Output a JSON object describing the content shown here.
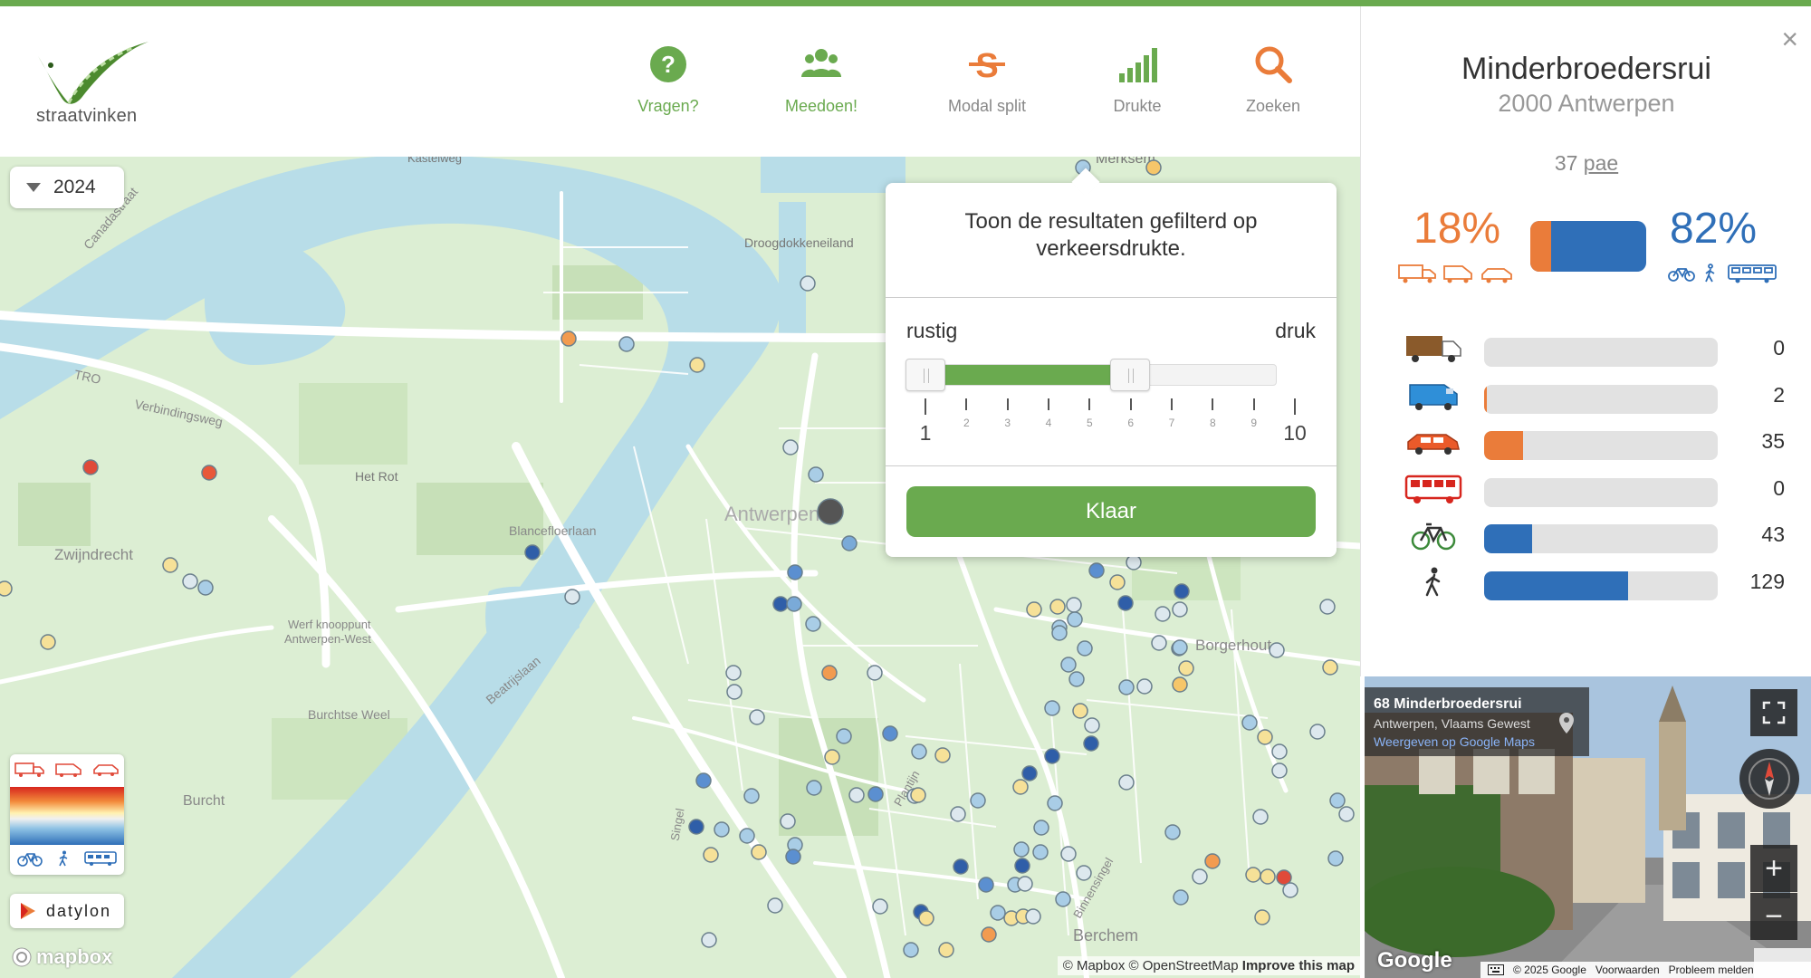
{
  "brand": {
    "name": "straatvinken"
  },
  "nav": [
    {
      "label": "Vragen?",
      "icon": "question-icon",
      "color": "#6aaa4f"
    },
    {
      "label": "Meedoen!",
      "icon": "people-icon",
      "color": "#6aaa4f"
    },
    {
      "label": "Modal split",
      "icon": "modal-split-icon",
      "color": "#888888"
    },
    {
      "label": "Drukte",
      "icon": "signal-bars-icon",
      "color": "#888888"
    },
    {
      "label": "Zoeken",
      "icon": "search-icon",
      "color": "#888888"
    }
  ],
  "map": {
    "year": "2024",
    "labels": {
      "kastelweg": "Kastelweg",
      "merksem": "Merksem",
      "canadastraat": "Canadastraat",
      "droogdokken": "Droogdokkeneiland",
      "tro": "TRO",
      "verbindingsweg": "Verbindingsweg",
      "hetrot": "Het Rot",
      "antwerpen": "Antwerpen",
      "blancefloer": "Blancefloerlaan",
      "zwijndrecht": "Zwijndrecht",
      "werf1": "Werf knooppunt",
      "werf2": "Antwerpen-West",
      "burchtseweel": "Burchtse Weel",
      "beatrijslaan": "Beatrijslaan",
      "burcht": "Burcht",
      "borgerhout": "Borgerhout",
      "berchem": "Berchem",
      "singel": "Singel",
      "binnensingel": "Binnensingel",
      "plantijn": "Plantijn"
    },
    "legend_icons_top": [
      "truck-icon",
      "van-icon",
      "car-icon"
    ],
    "legend_icons_bottom": [
      "bike-icon",
      "pedestrian-icon",
      "bus-icon"
    ],
    "datylon": "datylon",
    "mapbox": "mapbox",
    "attribution": {
      "mapbox": "© Mapbox",
      "osm": "© OpenStreetMap",
      "improve": "Improve this map"
    }
  },
  "popup": {
    "title": "Toon de resultaten gefilterd op verkeersdrukte.",
    "low_label": "rustig",
    "high_label": "druk",
    "ticks": [
      "1",
      "2",
      "3",
      "4",
      "5",
      "6",
      "7",
      "8",
      "9",
      "10"
    ],
    "range_min": 1,
    "range_max": 6,
    "button": "Klaar"
  },
  "sidebar": {
    "close": "×",
    "street": "Minderbroedersrui",
    "city": "2000 Antwerpen",
    "pae_value": "37",
    "pae_unit": "pae",
    "motor_pct": "18%",
    "active_pct": "82%",
    "motor_fraction": 0.18,
    "colors": {
      "motor": "#ea7c3a",
      "active": "#2f6fb8"
    },
    "modes": [
      {
        "icon": "truck-icon",
        "count": "0",
        "value": 0,
        "color": "#ea7c3a"
      },
      {
        "icon": "van-icon",
        "count": "2",
        "value": 2,
        "color": "#ea7c3a"
      },
      {
        "icon": "car-icon",
        "count": "35",
        "value": 35,
        "color": "#ea7c3a"
      },
      {
        "icon": "bus-icon",
        "count": "0",
        "value": 0,
        "color": "#2f6fb8"
      },
      {
        "icon": "bike-icon",
        "count": "43",
        "value": 43,
        "color": "#2f6fb8"
      },
      {
        "icon": "pedestrian-icon",
        "count": "129",
        "value": 129,
        "color": "#2f6fb8"
      }
    ],
    "max_value": 209
  },
  "streetview": {
    "address": "68 Minderbroedersrui",
    "region": "Antwerpen, Vlaams Gewest",
    "link": "Weergeven op Google Maps",
    "google": "Google",
    "copyright": "© 2025 Google",
    "terms": "Voorwaarden",
    "report": "Probleem melden"
  }
}
